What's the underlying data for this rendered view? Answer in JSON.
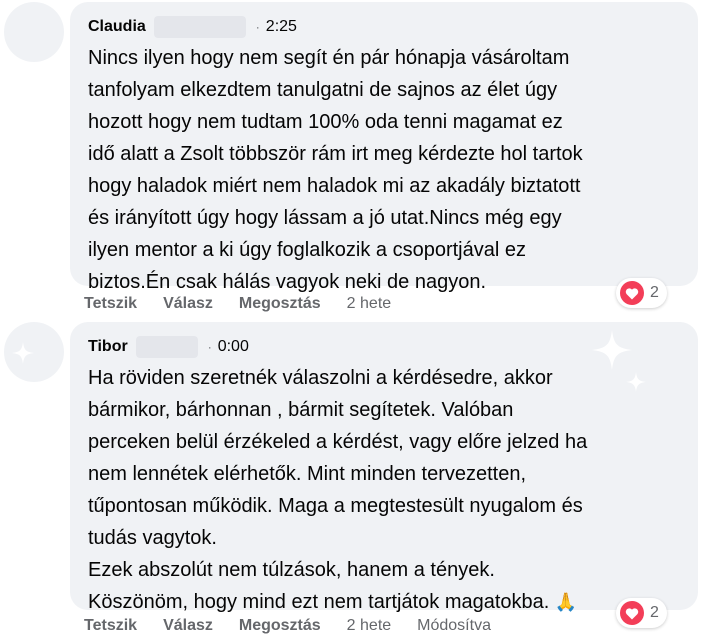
{
  "colors": {
    "bubble": "#f0f2f5",
    "heart": "#f33e58",
    "muted": "#65676b",
    "text": "#050505"
  },
  "comments": [
    {
      "author": "Claudia",
      "time": "2:25",
      "text_lines": [
        "Nincs ilyen hogy nem segít én pár hónapja vásároltam",
        "tanfolyam elkezdtem tanulgatni de sajnos az élet úgy",
        "hozott hogy nem tudtam 100% oda tenni magamat ez",
        "idő alatt a Zsolt többször rám irt meg kérdezte hol tartok",
        "hogy haladok miért nem haladok mi az akadály biztatott",
        "és irányított úgy hogy lássam a jó utat.Nincs még egy",
        "ilyen mentor a ki úgy foglalkozik a csoportjával ez",
        "biztos.Én csak hálás vagyok neki de nagyon."
      ],
      "actions": {
        "like": "Tetszik",
        "reply": "Válasz",
        "share": "Megosztás",
        "age": "2 hete"
      },
      "reaction": {
        "icon": "heart-icon",
        "count": "2"
      }
    },
    {
      "author": "Tibor",
      "time": "0:00",
      "text_lines": [
        "Ha röviden szeretnék válaszolni a kérdésedre, akkor",
        "bármikor, bárhonnan , bármit segítetek. Valóban",
        "perceken belül érzékeled a kérdést, vagy előre jelzed ha",
        "nem lennétek elérhetők. Mint minden tervezetten,",
        "tűpontosan működik. Maga a megtestesült nyugalom és",
        "tudás vagytok.",
        "Ezek abszolút nem túlzások, hanem a tények.",
        "Köszönöm, hogy mind ezt nem tartjátok magatokba."
      ],
      "emoji": "🙏",
      "actions": {
        "like": "Tetszik",
        "reply": "Válasz",
        "share": "Megosztás",
        "age": "2 hete",
        "edited": "Módosítva"
      },
      "reaction": {
        "icon": "heart-icon",
        "count": "2"
      }
    }
  ]
}
